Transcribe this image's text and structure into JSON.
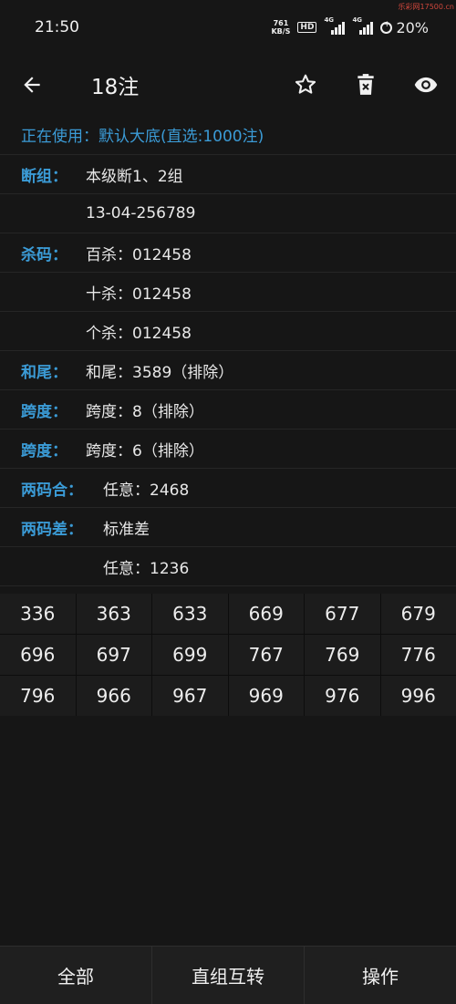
{
  "status_bar": {
    "time": "21:50",
    "speed_value": "761",
    "speed_unit": "KB/S",
    "hd_label": "HD",
    "net1": "4G",
    "net2": "4G",
    "battery": "20%",
    "watermark": "乐彩网17500.cn"
  },
  "app_bar": {
    "title": "18注",
    "icons": [
      "arrow-left-icon",
      "star-outline-icon",
      "delete-icon",
      "eye-icon"
    ]
  },
  "active_row": "正在使用：默认大底(直选:1000注)",
  "rows": [
    {
      "label": "断组：",
      "value": "本级断1、2组"
    },
    {
      "label": "",
      "value": "13-04-256789"
    },
    {
      "label": "杀码：",
      "value": "百杀：012458"
    },
    {
      "label": "",
      "value": "十杀：012458"
    },
    {
      "label": "",
      "value": "个杀：012458"
    },
    {
      "label": "和尾：",
      "value": "和尾：3589（排除）"
    },
    {
      "label": "跨度：",
      "value": "跨度：8（排除）"
    },
    {
      "label": "跨度：",
      "value": "跨度：6（排除）"
    },
    {
      "label": "两码合：",
      "value": "任意：2468"
    },
    {
      "label": "两码差：",
      "value": "标准差"
    },
    {
      "label": "",
      "value": "任意：1236"
    }
  ],
  "numbers": [
    "336",
    "363",
    "633",
    "669",
    "677",
    "679",
    "696",
    "697",
    "699",
    "767",
    "769",
    "776",
    "796",
    "966",
    "967",
    "969",
    "976",
    "996"
  ],
  "bottom_bar": {
    "all": "全部",
    "convert": "直组互转",
    "operate": "操作"
  },
  "colors": {
    "accent": "#3b9bd6",
    "background": "#161616"
  }
}
